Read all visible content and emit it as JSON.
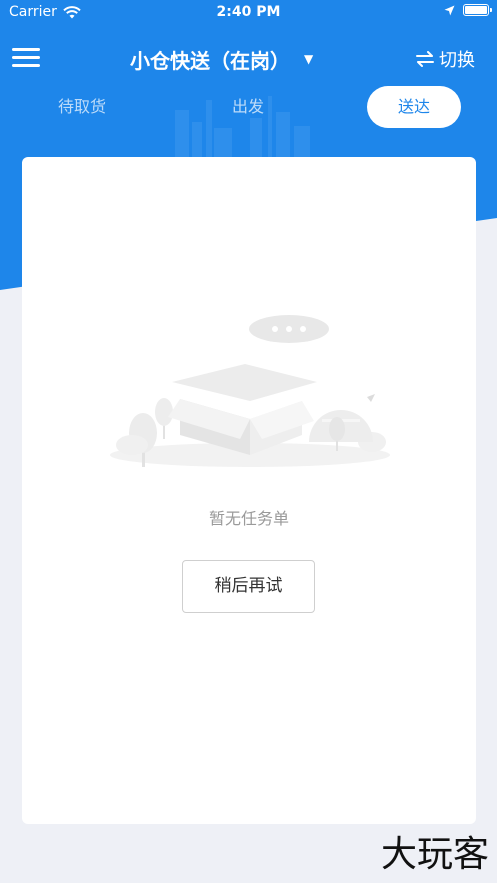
{
  "status_bar": {
    "carrier": "Carrier",
    "time": "2:40 PM"
  },
  "header": {
    "title": "小仓快送（在岗）",
    "switch_label": "切换",
    "tabs": [
      {
        "label": "待取货",
        "active": false
      },
      {
        "label": "出发",
        "active": false
      },
      {
        "label": "送达",
        "active": true
      }
    ]
  },
  "main": {
    "empty_message": "暂无任务单",
    "retry_label": "稍后再试"
  },
  "watermark": "大玩客",
  "colors": {
    "primary": "#1e86ea",
    "background": "#eef0f6",
    "card": "#ffffff"
  }
}
